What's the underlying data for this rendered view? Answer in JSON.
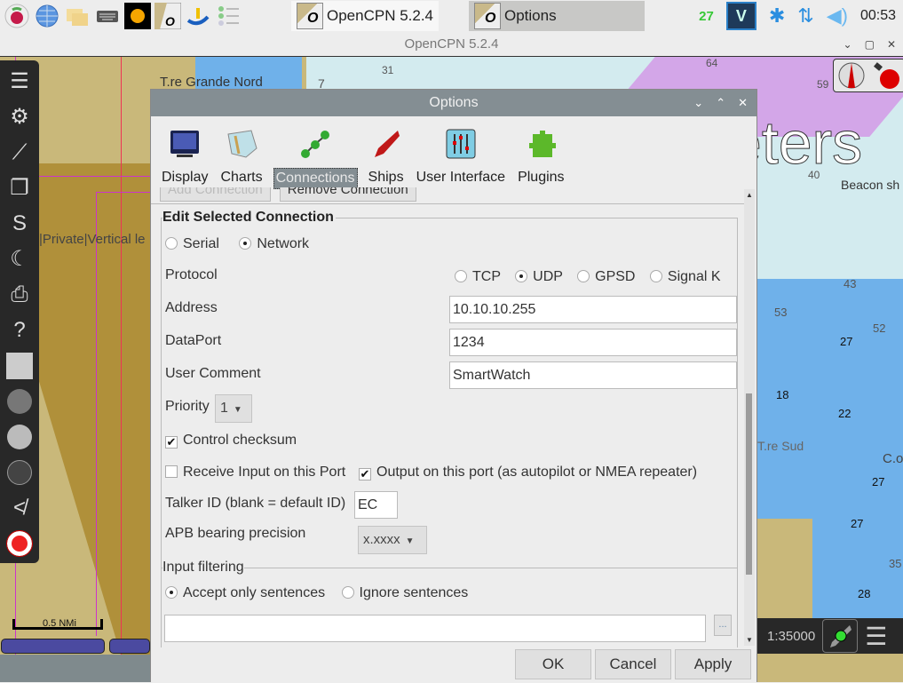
{
  "taskbar": {
    "launchers": [
      "raspberry-menu",
      "web-browser",
      "file-manager",
      "keyboard",
      "weather",
      "opencpn",
      "boat-app",
      "task-list"
    ],
    "apps": [
      {
        "label": "OpenCPN 5.2.4"
      },
      {
        "label": "Options"
      }
    ],
    "tray": {
      "cpu": "27",
      "vnc": "V",
      "clock": "00:53"
    }
  },
  "main_window": {
    "title": "OpenCPN 5.2.4",
    "controls": [
      "v",
      "□",
      "x"
    ]
  },
  "chart": {
    "labels": [
      "T.re Grande Nord",
      "|Private|Vertical le",
      "eters",
      "Beacon sh",
      "T.re Sud",
      "C.o"
    ],
    "soundings": [
      "7",
      "31",
      "64",
      "59",
      "40",
      "43",
      "53",
      "52",
      "27",
      "18",
      "22",
      "27",
      "35",
      "28",
      "27"
    ],
    "scale_label": "0.5 NMi",
    "scale_ratio": "1:35000"
  },
  "left_toolbar": [
    "menu",
    "settings",
    "route",
    "documents",
    "track",
    "night-mode",
    "print",
    "help",
    "chart-quilt",
    "globe",
    "dashboard",
    "compass-rose",
    "tides",
    "mob"
  ],
  "dialog": {
    "title": "Options",
    "controls": [
      "v",
      "^",
      "x"
    ],
    "tabs": [
      {
        "label": "Display",
        "active": false
      },
      {
        "label": "Charts",
        "active": false
      },
      {
        "label": "Connections",
        "active": true
      },
      {
        "label": "Ships",
        "active": false
      },
      {
        "label": "User Interface",
        "active": false
      },
      {
        "label": "Plugins",
        "active": false
      }
    ],
    "add_connection": "Add Connection",
    "remove_connection": "Remove Connection",
    "edit": {
      "title": "Edit Selected Connection",
      "type_serial": "Serial",
      "type_network": "Network",
      "type_selected": "Network",
      "protocol_label": "Protocol",
      "protocols": [
        "TCP",
        "UDP",
        "GPSD",
        "Signal K"
      ],
      "protocol_selected": "UDP",
      "address_label": "Address",
      "address_value": "10.10.10.255",
      "dataport_label": "DataPort",
      "dataport_value": "1234",
      "comment_label": "User Comment",
      "comment_value": "SmartWatch",
      "priority_label": "Priority",
      "priority_value": "1",
      "checksum_label": "Control checksum",
      "checksum_checked": true,
      "receive_label": "Receive Input on this Port",
      "receive_checked": false,
      "output_label": "Output on this port (as autopilot or NMEA repeater)",
      "output_checked": true,
      "talker_label": "Talker ID (blank = default ID)",
      "talker_value": "EC",
      "apb_label": "APB bearing precision",
      "apb_value": "x.xxxx"
    },
    "filtering": {
      "title": "Input filtering",
      "accept_label": "Accept only sentences",
      "ignore_label": "Ignore sentences",
      "selected": "accept",
      "sentences_value": "",
      "browse_label": "..."
    },
    "footer": {
      "ok": "OK",
      "cancel": "Cancel",
      "apply": "Apply"
    }
  }
}
